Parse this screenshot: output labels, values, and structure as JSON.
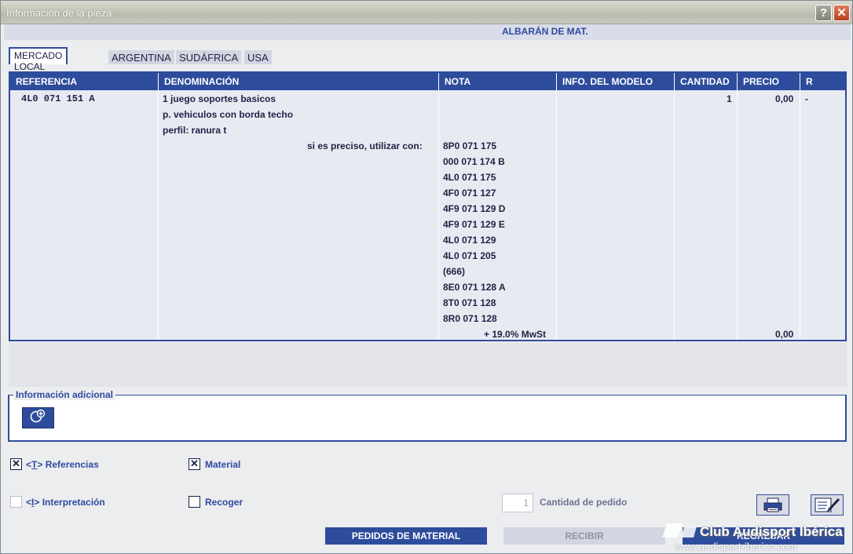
{
  "window": {
    "title": "Información de la pieza",
    "help_glyph": "?",
    "close_glyph": "✕"
  },
  "header": {
    "document_title": "ALBARÁN DE MAT."
  },
  "tabs": [
    {
      "label": "MERCADO LOCAL",
      "active": true
    },
    {
      "label": "ARGENTINA",
      "active": false
    },
    {
      "label": "SUDÁFRICA",
      "active": false
    },
    {
      "label": "USA",
      "active": false
    }
  ],
  "table": {
    "columns": [
      "REFERENCIA",
      "DENOMINACIÓN",
      "NOTA",
      "INFO. DEL MODELO",
      "CANTIDAD",
      "PRECIO",
      "R"
    ],
    "row": {
      "referencia": "4L0 071 151 A",
      "denominacion": [
        "1 juego soportes basicos",
        "p. vehiculos con borda techo",
        "perfil: ranura t"
      ],
      "substitute_label": "si es preciso, utilizar con:",
      "nota": [
        "8P0 071 175",
        "000 071 174 B",
        "4L0 071 175",
        "4F0 071 127",
        "4F9 071 129 D",
        "4F9 071 129 E",
        "4L0 071 129",
        "4L0 071 205",
        "(666)",
        "8E0 071 128 A",
        "8T0 071 128",
        "8R0 071 128"
      ],
      "cantidad": "1",
      "precio": "0,00",
      "r": "-",
      "tax_label": "+ 19.0% MwSt",
      "tax_value": "0,00"
    }
  },
  "additional_info": {
    "legend": "Información adicional",
    "add_icon": "circle-plus-icon"
  },
  "options": {
    "referencias": {
      "label_prefix": "<",
      "label_key": "T",
      "label_rest": "> Referencias",
      "checked": true
    },
    "material": {
      "label": "Material",
      "checked": true
    },
    "interpretacion": {
      "label_prefix": "<",
      "label_key": "I",
      "label_rest": "> Interpretación",
      "checked": false,
      "enabled": false
    },
    "recoger": {
      "label": "Recoger",
      "checked": false
    }
  },
  "order_quantity": {
    "value": "1",
    "label": "Cantidad de pedido"
  },
  "buttons": {
    "pedidos": "PEDIDOS DE MATERIAL",
    "recibir": "RECIBIR",
    "third": "REGRESAR"
  },
  "watermark": {
    "text": "Club Audisport Ibérica",
    "url": "www.audisport-iberica.com"
  },
  "colors": {
    "accent": "#2e4c9c",
    "background": "#ecedef",
    "row_bg": "#e8eaf1"
  }
}
